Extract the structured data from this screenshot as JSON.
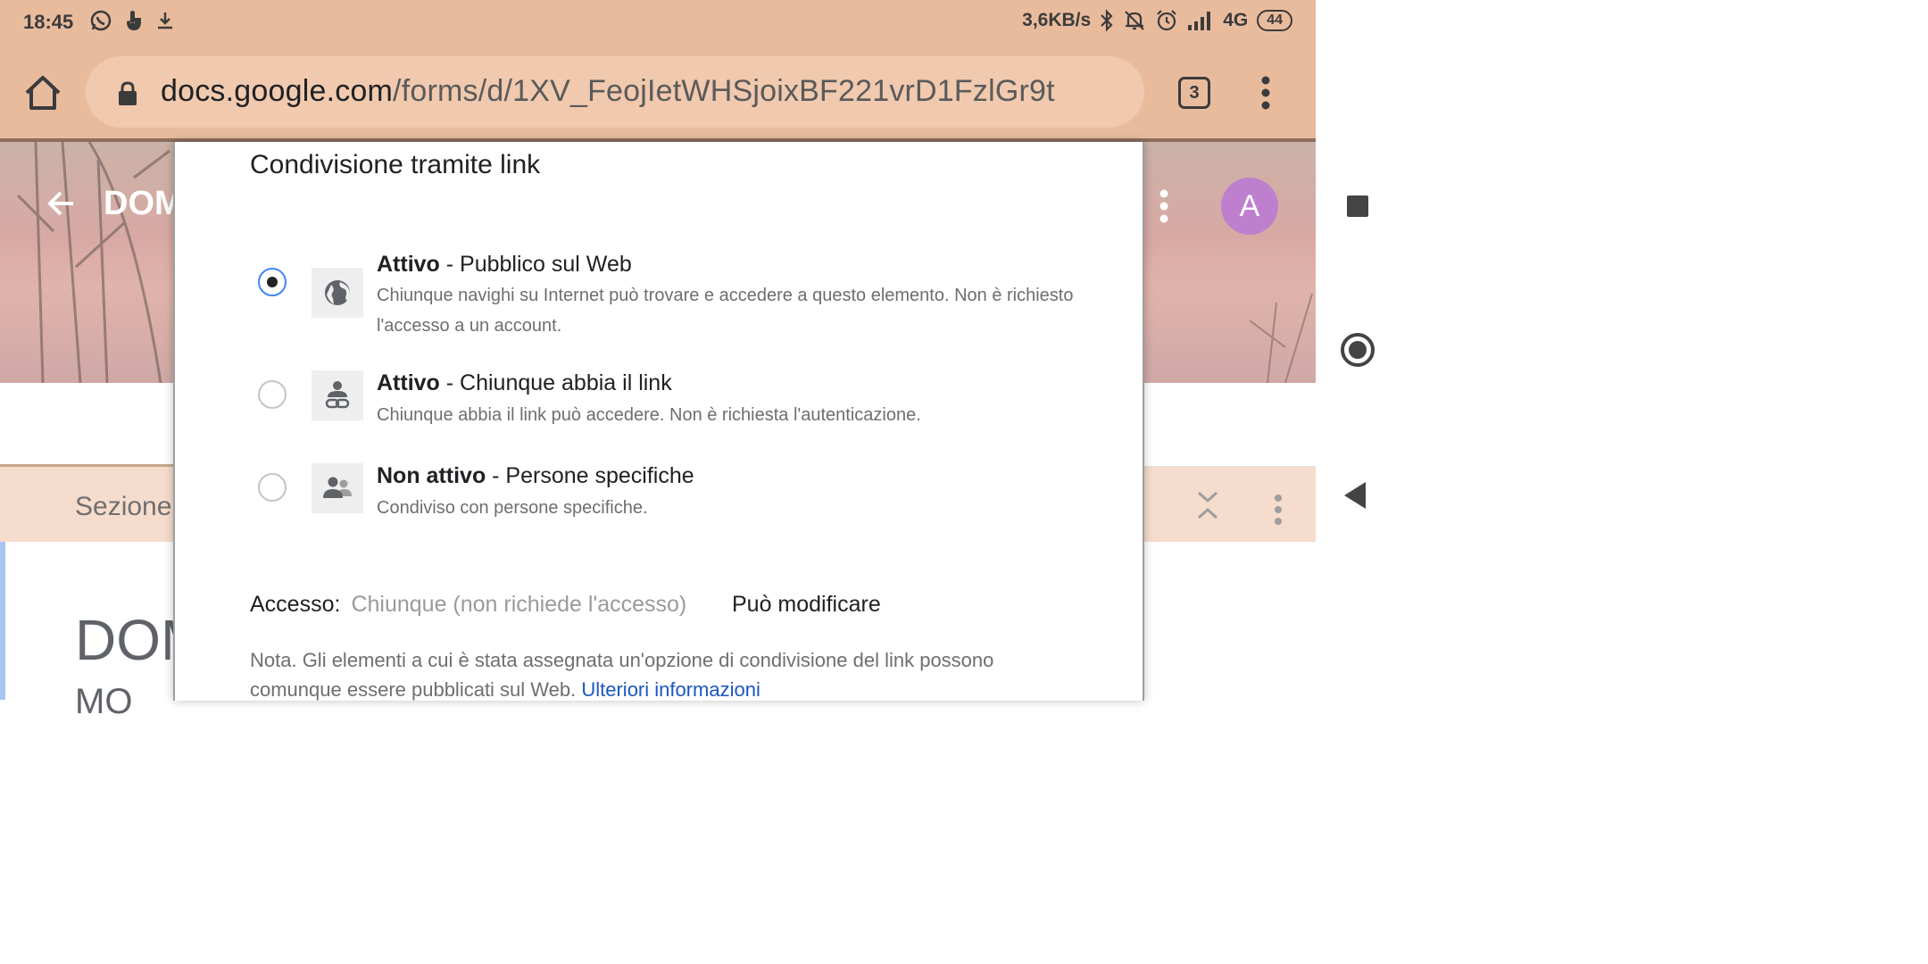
{
  "status_bar": {
    "time": "18:45",
    "network_speed": "3,6KB/s",
    "network_type": "4G",
    "battery": "44",
    "left_icons": [
      "whatsapp-icon",
      "touch-icon",
      "download-icon"
    ],
    "right_icons": [
      "bluetooth-icon",
      "mute-icon",
      "alarm-icon",
      "signal-icon"
    ]
  },
  "browser": {
    "url_host": "docs.google.com",
    "url_path": "/forms/d/1XV_FeojIetWHSjoixBF221vrD1FzlGr9t",
    "tab_count": "3"
  },
  "page": {
    "form_title_partial": "DOM",
    "avatar_letter": "A",
    "section_label_partial": "Sezione",
    "doc_title_partial": "DOM",
    "doc_title_line2_partial": "MO"
  },
  "dialog": {
    "title": "Condivisione tramite link",
    "options": [
      {
        "status": "Attivo",
        "label": " - Pubblico sul Web",
        "description": "Chiunque navighi su Internet può trovare e accedere a questo elemento. Non è richiesto l'accesso a un account.",
        "icon": "globe-icon",
        "selected": true
      },
      {
        "status": "Attivo",
        "label": " - Chiunque abbia il link",
        "description": "Chiunque abbia il link può accedere. Non è richiesta l'autenticazione.",
        "icon": "person-link-icon",
        "selected": false
      },
      {
        "status": "Non attivo",
        "label": " - Persone specifiche",
        "description": "Condiviso con persone specifiche.",
        "icon": "people-icon",
        "selected": false
      }
    ],
    "access_label": "Accesso:",
    "access_value": "Chiunque (non richiede l'accesso)",
    "access_permission": "Può modificare",
    "note_text": "Nota. Gli elementi a cui è stata assegnata un'opzione di condivisione del link possono comunque essere pubblicati sul Web. ",
    "note_link": "Ulteriori informazioni"
  },
  "colors": {
    "browser_chrome": "#e9bb9d",
    "radio_selected": "#4285f4",
    "link": "#1a56c4",
    "avatar": "#bf7fcf"
  }
}
